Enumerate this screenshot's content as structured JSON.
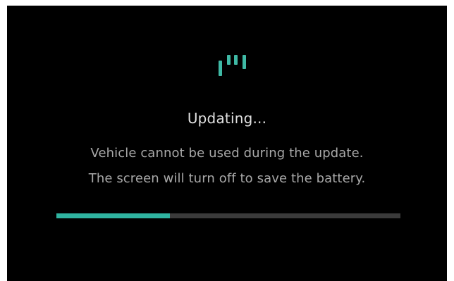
{
  "status": {
    "title": "Updating...",
    "message_line1": "Vehicle cannot be used during the update.",
    "message_line2": "The screen will turn off to save the battery."
  },
  "progress": {
    "fraction": 0.33
  },
  "logo": {
    "icon": "brand-logo-icon",
    "color": "#3fb9a5"
  },
  "colors": {
    "background": "#000000",
    "accent": "#2fb3a0",
    "track": "#3a3a3a",
    "text_primary": "#e0e0e0",
    "text_secondary": "#a8a8a8"
  }
}
